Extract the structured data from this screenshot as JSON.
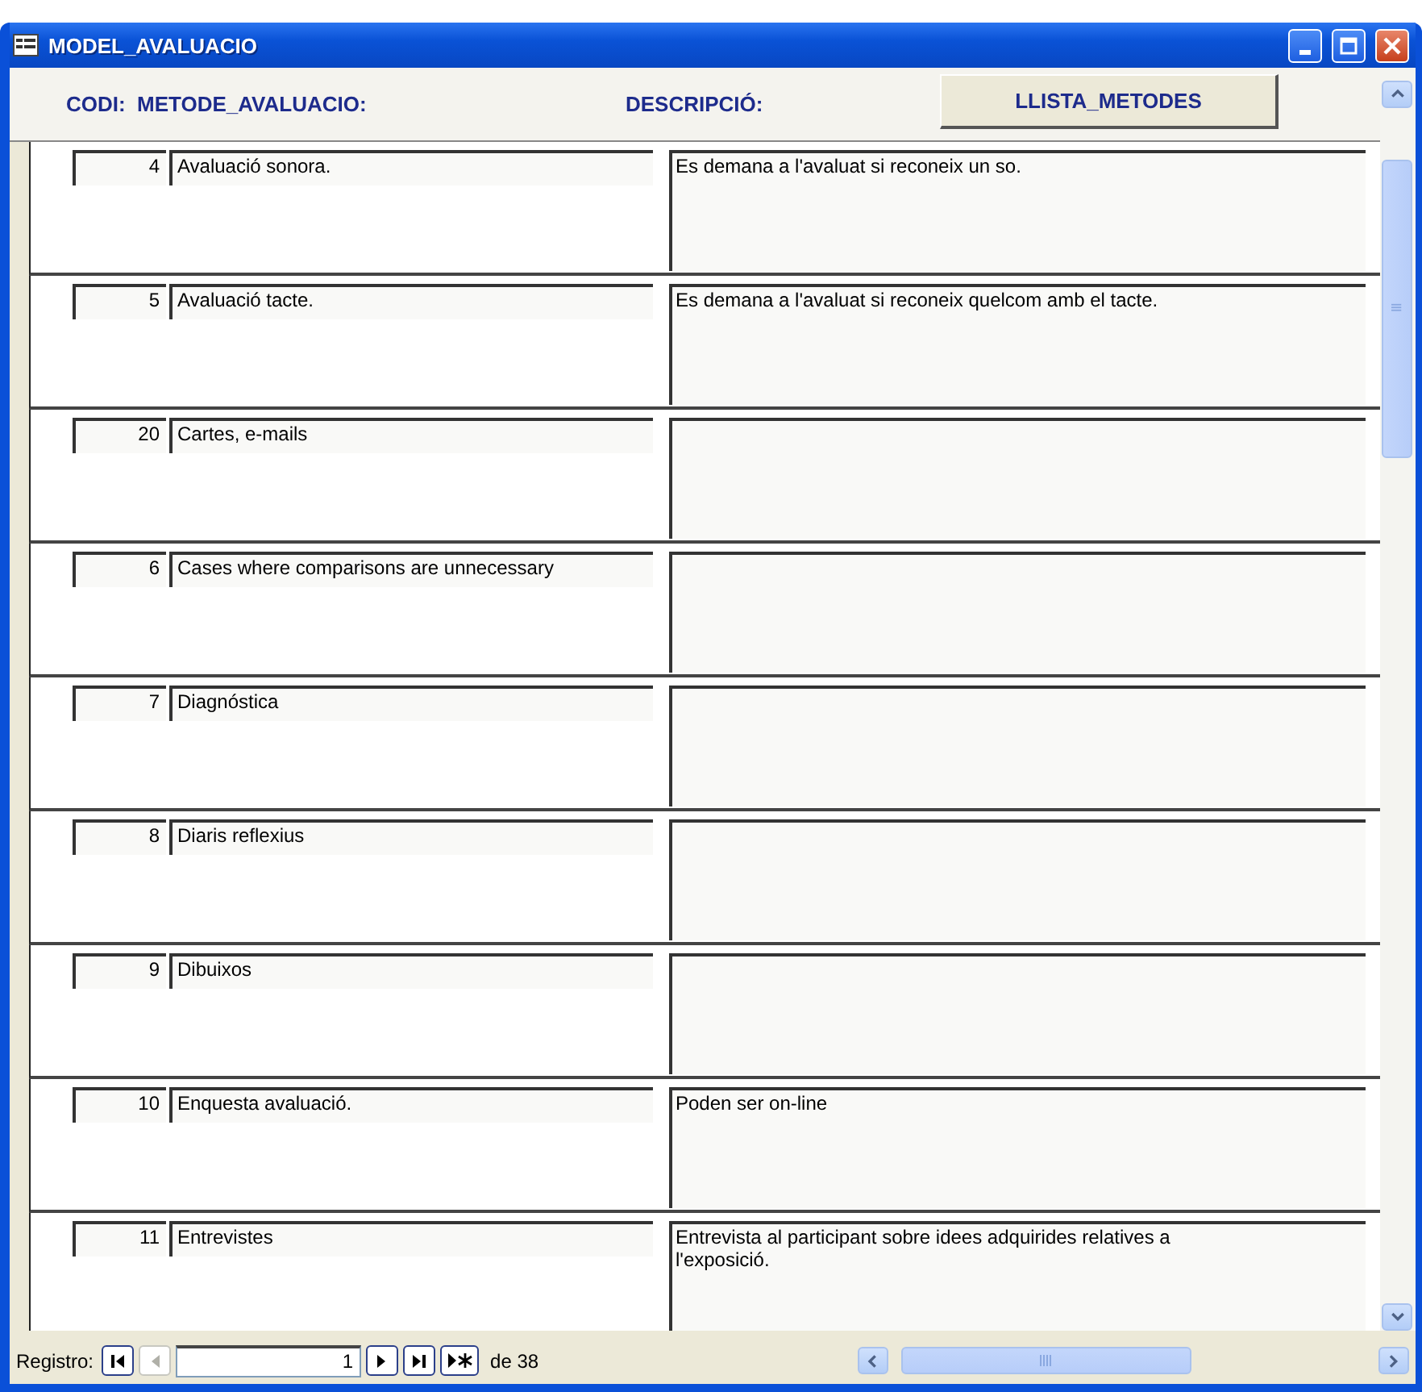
{
  "window": {
    "title": "MODEL_AVALUACIO"
  },
  "header": {
    "columns": [
      "CODI:",
      "METODE_AVALUACIO:",
      "DESCRIPCIÓ:"
    ],
    "button": "LLISTA_METODES"
  },
  "records": [
    {
      "codi": "4",
      "metode": "Avaluació sonora.",
      "descripcio": "Es demana a l'avaluat si reconeix un so."
    },
    {
      "codi": "5",
      "metode": "Avaluació tacte.",
      "descripcio": "Es demana a l'avaluat si reconeix quelcom amb el tacte."
    },
    {
      "codi": "20",
      "metode": "Cartes, e-mails"
    },
    {
      "codi": "6",
      "metode": "Cases where comparisons are unnecessary"
    },
    {
      "codi": "7",
      "metode": "Diagnóstica"
    },
    {
      "codi": "8",
      "metode": "Diaris reflexius"
    },
    {
      "codi": "9",
      "metode": "Dibuixos"
    },
    {
      "codi": "10",
      "metode": "Enquesta avaluació.",
      "descripcio": "Poden ser on-line"
    },
    {
      "codi": "11",
      "metode": "Entrevistes",
      "descripcio": "Entrevista al participant sobre idees adquirides relatives a l'exposició."
    }
  ],
  "navigation": {
    "label": "Registro:",
    "current": "1",
    "total": "de 38",
    "buttons": [
      {
        "kind": "first",
        "disabled": false
      },
      {
        "kind": "prev",
        "disabled": true
      },
      {
        "kind": "next",
        "disabled": false
      },
      {
        "kind": "last",
        "disabled": false
      },
      {
        "kind": "new",
        "disabled": false
      }
    ]
  }
}
